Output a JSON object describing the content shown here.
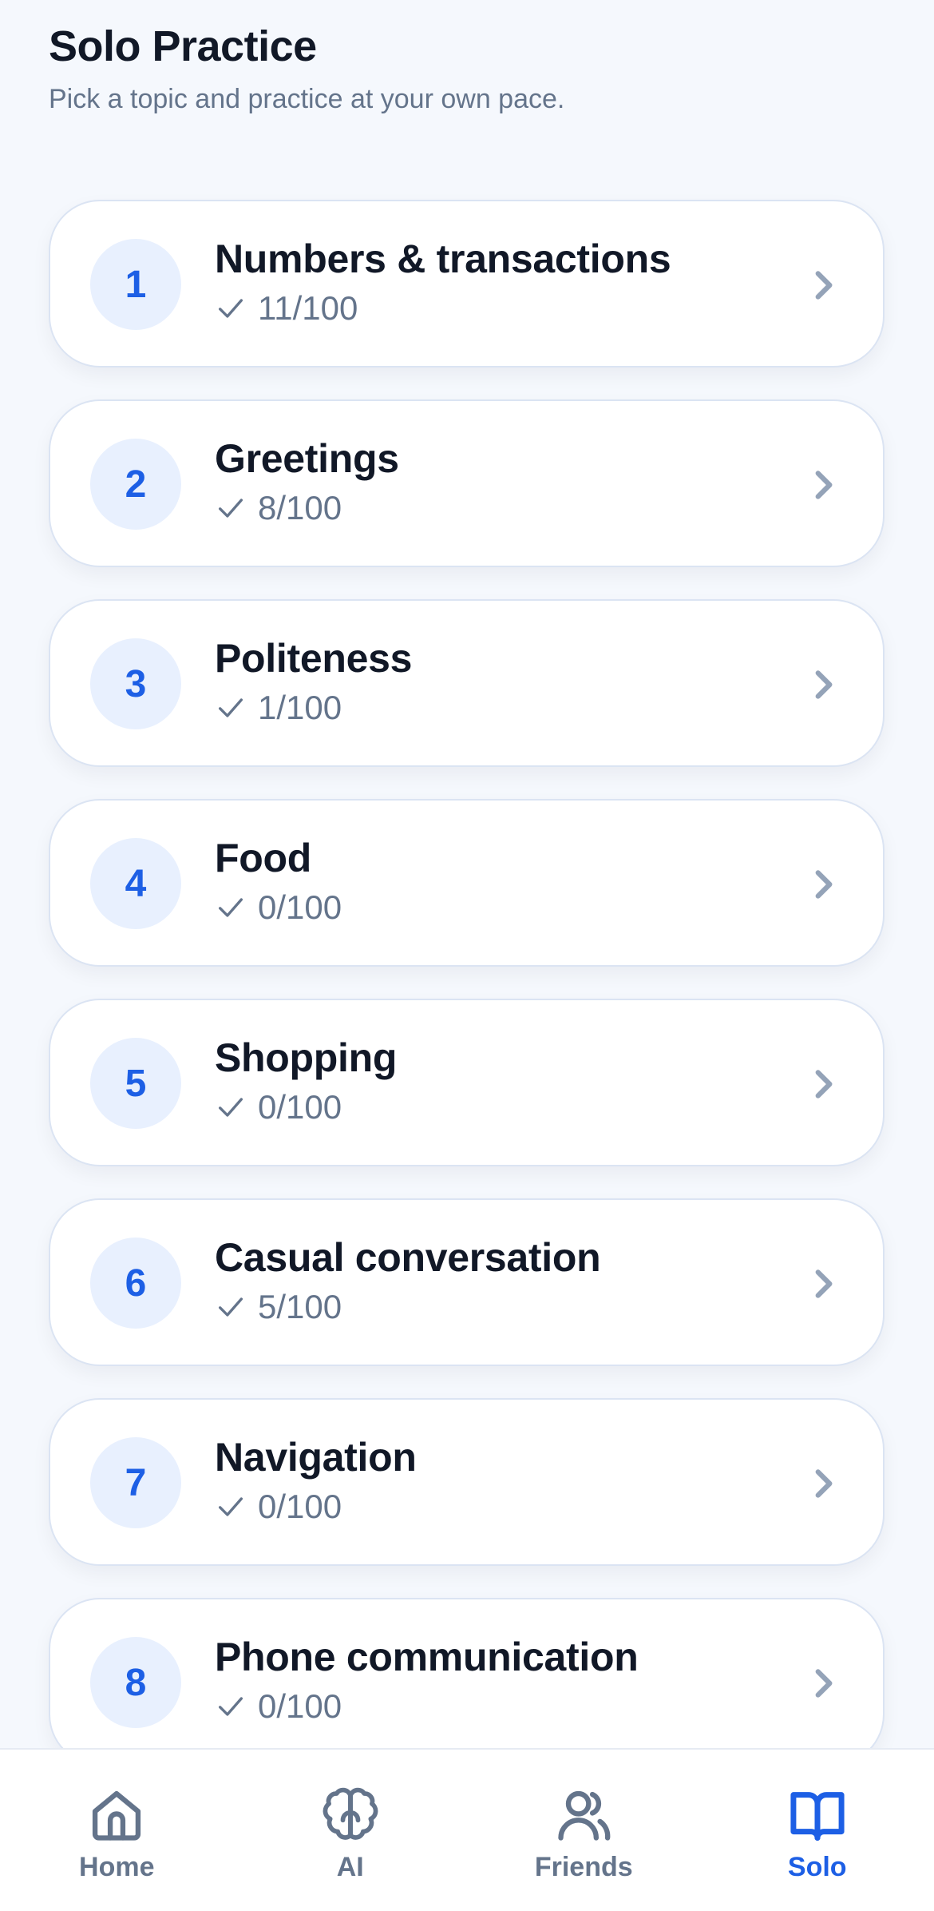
{
  "header": {
    "title": "Solo Practice",
    "subtitle": "Pick a topic and practice at your own pace."
  },
  "topics": [
    {
      "number": "1",
      "title": "Numbers & transactions",
      "progress": "11/100"
    },
    {
      "number": "2",
      "title": "Greetings",
      "progress": "8/100"
    },
    {
      "number": "3",
      "title": "Politeness",
      "progress": "1/100"
    },
    {
      "number": "4",
      "title": "Food",
      "progress": "0/100"
    },
    {
      "number": "5",
      "title": "Shopping",
      "progress": "0/100"
    },
    {
      "number": "6",
      "title": "Casual conversation",
      "progress": "5/100"
    },
    {
      "number": "7",
      "title": "Navigation",
      "progress": "0/100"
    },
    {
      "number": "8",
      "title": "Phone communication",
      "progress": "0/100"
    }
  ],
  "tabbar": {
    "tabs": [
      {
        "label": "Home",
        "icon": "home-icon"
      },
      {
        "label": "AI",
        "icon": "brain-icon"
      },
      {
        "label": "Friends",
        "icon": "users-icon"
      },
      {
        "label": "Solo",
        "icon": "book-icon"
      }
    ],
    "active": "Solo"
  },
  "colors": {
    "accent": "#1d5fe5",
    "muted": "#64748b",
    "background": "#f5f8fd",
    "badge_bg": "#e8f0fe"
  }
}
